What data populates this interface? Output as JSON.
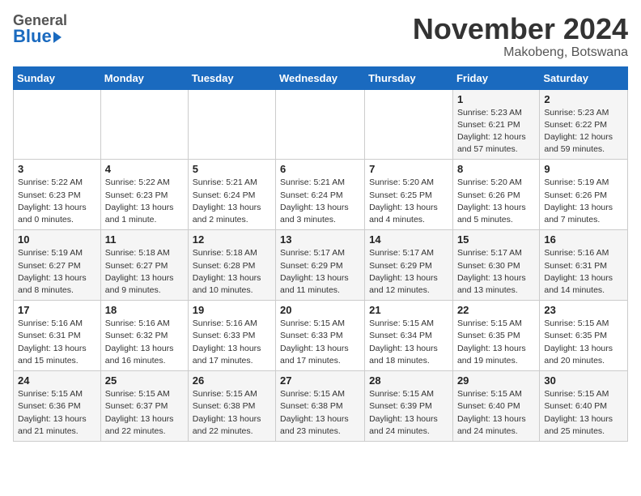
{
  "header": {
    "logo_general": "General",
    "logo_blue": "Blue",
    "title": "November 2024",
    "subtitle": "Makobeng, Botswana"
  },
  "calendar": {
    "days_of_week": [
      "Sunday",
      "Monday",
      "Tuesday",
      "Wednesday",
      "Thursday",
      "Friday",
      "Saturday"
    ],
    "weeks": [
      [
        {
          "num": "",
          "info": ""
        },
        {
          "num": "",
          "info": ""
        },
        {
          "num": "",
          "info": ""
        },
        {
          "num": "",
          "info": ""
        },
        {
          "num": "",
          "info": ""
        },
        {
          "num": "1",
          "info": "Sunrise: 5:23 AM\nSunset: 6:21 PM\nDaylight: 12 hours\nand 57 minutes."
        },
        {
          "num": "2",
          "info": "Sunrise: 5:23 AM\nSunset: 6:22 PM\nDaylight: 12 hours\nand 59 minutes."
        }
      ],
      [
        {
          "num": "3",
          "info": "Sunrise: 5:22 AM\nSunset: 6:23 PM\nDaylight: 13 hours\nand 0 minutes."
        },
        {
          "num": "4",
          "info": "Sunrise: 5:22 AM\nSunset: 6:23 PM\nDaylight: 13 hours\nand 1 minute."
        },
        {
          "num": "5",
          "info": "Sunrise: 5:21 AM\nSunset: 6:24 PM\nDaylight: 13 hours\nand 2 minutes."
        },
        {
          "num": "6",
          "info": "Sunrise: 5:21 AM\nSunset: 6:24 PM\nDaylight: 13 hours\nand 3 minutes."
        },
        {
          "num": "7",
          "info": "Sunrise: 5:20 AM\nSunset: 6:25 PM\nDaylight: 13 hours\nand 4 minutes."
        },
        {
          "num": "8",
          "info": "Sunrise: 5:20 AM\nSunset: 6:26 PM\nDaylight: 13 hours\nand 5 minutes."
        },
        {
          "num": "9",
          "info": "Sunrise: 5:19 AM\nSunset: 6:26 PM\nDaylight: 13 hours\nand 7 minutes."
        }
      ],
      [
        {
          "num": "10",
          "info": "Sunrise: 5:19 AM\nSunset: 6:27 PM\nDaylight: 13 hours\nand 8 minutes."
        },
        {
          "num": "11",
          "info": "Sunrise: 5:18 AM\nSunset: 6:27 PM\nDaylight: 13 hours\nand 9 minutes."
        },
        {
          "num": "12",
          "info": "Sunrise: 5:18 AM\nSunset: 6:28 PM\nDaylight: 13 hours\nand 10 minutes."
        },
        {
          "num": "13",
          "info": "Sunrise: 5:17 AM\nSunset: 6:29 PM\nDaylight: 13 hours\nand 11 minutes."
        },
        {
          "num": "14",
          "info": "Sunrise: 5:17 AM\nSunset: 6:29 PM\nDaylight: 13 hours\nand 12 minutes."
        },
        {
          "num": "15",
          "info": "Sunrise: 5:17 AM\nSunset: 6:30 PM\nDaylight: 13 hours\nand 13 minutes."
        },
        {
          "num": "16",
          "info": "Sunrise: 5:16 AM\nSunset: 6:31 PM\nDaylight: 13 hours\nand 14 minutes."
        }
      ],
      [
        {
          "num": "17",
          "info": "Sunrise: 5:16 AM\nSunset: 6:31 PM\nDaylight: 13 hours\nand 15 minutes."
        },
        {
          "num": "18",
          "info": "Sunrise: 5:16 AM\nSunset: 6:32 PM\nDaylight: 13 hours\nand 16 minutes."
        },
        {
          "num": "19",
          "info": "Sunrise: 5:16 AM\nSunset: 6:33 PM\nDaylight: 13 hours\nand 17 minutes."
        },
        {
          "num": "20",
          "info": "Sunrise: 5:15 AM\nSunset: 6:33 PM\nDaylight: 13 hours\nand 17 minutes."
        },
        {
          "num": "21",
          "info": "Sunrise: 5:15 AM\nSunset: 6:34 PM\nDaylight: 13 hours\nand 18 minutes."
        },
        {
          "num": "22",
          "info": "Sunrise: 5:15 AM\nSunset: 6:35 PM\nDaylight: 13 hours\nand 19 minutes."
        },
        {
          "num": "23",
          "info": "Sunrise: 5:15 AM\nSunset: 6:35 PM\nDaylight: 13 hours\nand 20 minutes."
        }
      ],
      [
        {
          "num": "24",
          "info": "Sunrise: 5:15 AM\nSunset: 6:36 PM\nDaylight: 13 hours\nand 21 minutes."
        },
        {
          "num": "25",
          "info": "Sunrise: 5:15 AM\nSunset: 6:37 PM\nDaylight: 13 hours\nand 22 minutes."
        },
        {
          "num": "26",
          "info": "Sunrise: 5:15 AM\nSunset: 6:38 PM\nDaylight: 13 hours\nand 22 minutes."
        },
        {
          "num": "27",
          "info": "Sunrise: 5:15 AM\nSunset: 6:38 PM\nDaylight: 13 hours\nand 23 minutes."
        },
        {
          "num": "28",
          "info": "Sunrise: 5:15 AM\nSunset: 6:39 PM\nDaylight: 13 hours\nand 24 minutes."
        },
        {
          "num": "29",
          "info": "Sunrise: 5:15 AM\nSunset: 6:40 PM\nDaylight: 13 hours\nand 24 minutes."
        },
        {
          "num": "30",
          "info": "Sunrise: 5:15 AM\nSunset: 6:40 PM\nDaylight: 13 hours\nand 25 minutes."
        }
      ]
    ]
  }
}
